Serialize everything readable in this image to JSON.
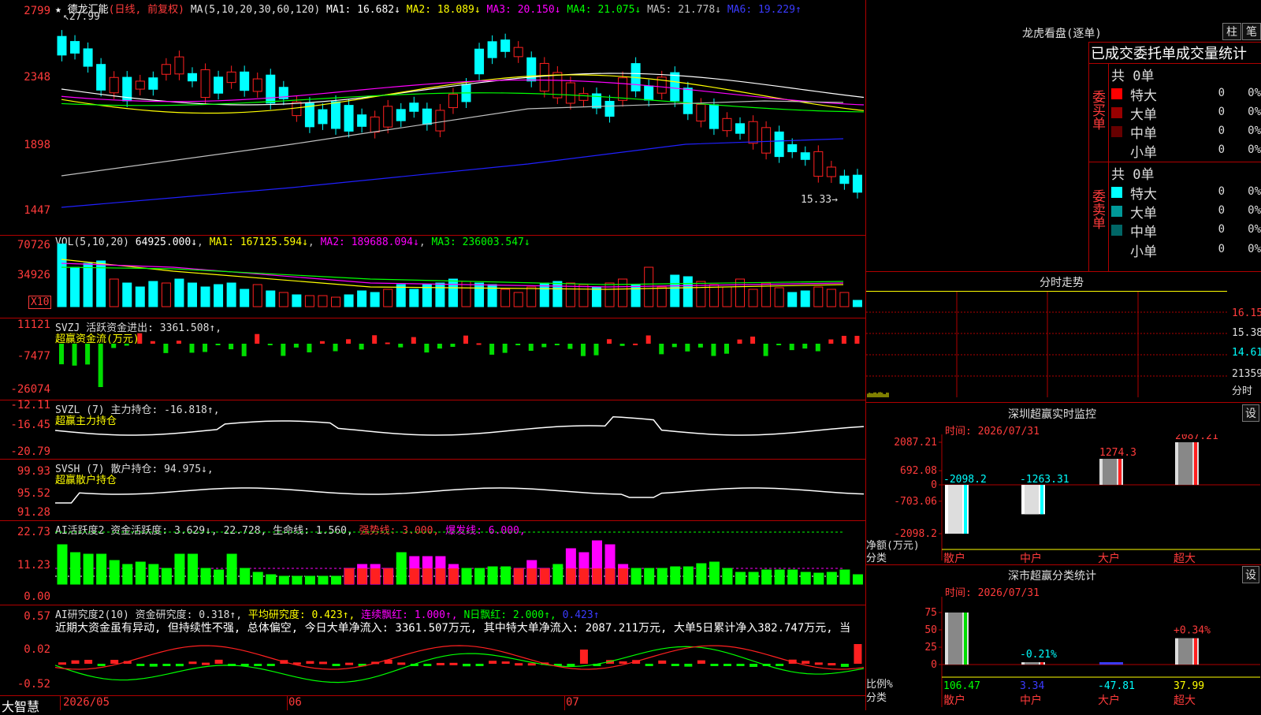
{
  "stock": {
    "name": "德龙汇能",
    "mode": "(日线, 前复权)",
    "ma_header": "MA(5,10,20,30,60,120)",
    "ma": [
      {
        "label": "MA1:",
        "value": "16.682↓",
        "color": "#ffffff"
      },
      {
        "label": "MA2:",
        "value": "18.089↓",
        "color": "#ffff00"
      },
      {
        "label": "MA3:",
        "value": "20.150↓",
        "color": "#ff00ff"
      },
      {
        "label": "MA4:",
        "value": "21.075↓",
        "color": "#00ff00"
      },
      {
        "label": "MA5:",
        "value": "21.778↓",
        "color": "#c0c0c0"
      },
      {
        "label": "MA6:",
        "value": "19.229↑",
        "color": "#3b3bff"
      }
    ],
    "price_axis": [
      "2799",
      "2348",
      "1898",
      "1447"
    ],
    "high_label": "27.99",
    "low_label": "15.33"
  },
  "volume": {
    "header": "VOL(5,10,20)",
    "vol": "64925.000↓",
    "ma1": "MA1: 167125.594↓",
    "ma2": "MA2: 189688.094↓",
    "ma3": "MA3: 236003.547↓",
    "axis": [
      "70726",
      "34926"
    ],
    "unit": "X10"
  },
  "svzj": {
    "header": "SVZJ  活跃资金进出: 3361.508↑,",
    "sub": "超赢资金流(万元)",
    "axis": [
      "11121",
      "-7477",
      "-26074"
    ]
  },
  "svzl": {
    "header": "SVZL (7) 主力持仓: -16.818↑,",
    "sub": "超赢主力持仓",
    "axis": [
      "-12.11",
      "-16.45",
      "-20.79"
    ]
  },
  "svsh": {
    "header": "SVSH (7) 散户持仓: 94.975↓,",
    "sub": "超赢散户持仓",
    "axis": [
      "99.93",
      "95.52",
      "91.28"
    ]
  },
  "ai_active": {
    "header": "AI活跃度2 资金活跃度: 3.629↓, 22.728, 生命线: 1.560,",
    "strong": "强势线: 3.000,",
    "burst": "爆发线: 6.000,",
    "axis": [
      "22.73",
      "11.23",
      "0.00"
    ]
  },
  "ai_research": {
    "header_a": "AI研究度2(10) 资金研究度: 0.318↑,",
    "avg": "平均研究度: 0.423↑,",
    "streak": "连续飘红: 1.000↑,",
    "nday": "N日飘红: 2.000↑,",
    "last": "0.423↑",
    "comment": "近期大资金虽有异动, 但持续性不强, 总体偏空, 今日大单净流入: 3361.507万元, 其中特大单净流入: 2087.211万元, 大单5日累计净入382.747万元, 当",
    "axis": [
      "0.57",
      "0.02",
      "-0.52"
    ]
  },
  "date_axis": {
    "brand": "大智慧",
    "labels": [
      "2026/05",
      "06",
      "07"
    ]
  },
  "right": {
    "dragon_title": "龙虎看盘(逐单)",
    "btn_a": "柱",
    "btn_b": "笔",
    "order_title": "已成交委托单成交量统计",
    "buy_side": {
      "vlabel": "委买单",
      "total": "共 0单",
      "rows": [
        {
          "label": "特大",
          "value": "0",
          "pct": "0%",
          "color": "#ff0000"
        },
        {
          "label": "大单",
          "value": "0",
          "pct": "0%",
          "color": "#990000"
        },
        {
          "label": "中单",
          "value": "0",
          "pct": "0%",
          "color": "#660000"
        },
        {
          "label": "小单",
          "value": "0",
          "pct": "0%",
          "color": "#000000"
        }
      ]
    },
    "sell_side": {
      "vlabel": "委卖单",
      "total": "共 0单",
      "rows": [
        {
          "label": "特大",
          "value": "0",
          "pct": "0%",
          "color": "#00ffff"
        },
        {
          "label": "大单",
          "value": "0",
          "pct": "0%",
          "color": "#009999"
        },
        {
          "label": "中单",
          "value": "0",
          "pct": "0%",
          "color": "#006666"
        },
        {
          "label": "小单",
          "value": "0",
          "pct": "0%",
          "color": "#000000"
        }
      ]
    },
    "intraday": {
      "title": "分时走势",
      "labels": [
        "16.15",
        "15.38",
        "14.61",
        "21359",
        "分时"
      ]
    },
    "sz_monitor": {
      "title": "深圳超赢实时监控",
      "btn": "设",
      "time": "时间: 2026/07/31",
      "axis": [
        "2087.21",
        "692.08",
        "0",
        "-703.06",
        "-2098.2"
      ],
      "ylabel": "净额(万元)",
      "xlabel": "分类",
      "categories": [
        "散户",
        "中户",
        "大户",
        "超大"
      ],
      "values": [
        -2098.2,
        -1263.31,
        1274.3,
        2087.21
      ],
      "value_labels": [
        "-2098.2",
        "-1263.31",
        "1274.3",
        "2087.21"
      ]
    },
    "sz_stats": {
      "title": "深市超赢分类统计",
      "btn": "设",
      "time": "时间: 2026/07/31",
      "axis": [
        "75",
        "50",
        "25",
        "0"
      ],
      "ylabel": "比例%",
      "xlabel": "分类",
      "categories": [
        "散户",
        "中户",
        "大户",
        "超大"
      ],
      "bottom_values": [
        "106.47",
        "3.34",
        "-47.81",
        "37.99"
      ],
      "pct_labels": [
        "",
        "-0.21%",
        "",
        "+0.34%"
      ]
    }
  },
  "chart_data": [
    {
      "type": "bar",
      "title": "深圳超赢实时监控",
      "ylabel": "净额(万元)",
      "xlabel": "分类",
      "categories": [
        "散户",
        "中户",
        "大户",
        "超大"
      ],
      "values": [
        -2098.2,
        -1263.31,
        1274.3,
        2087.21
      ],
      "ylim": [
        -2098.2,
        2087.21
      ]
    },
    {
      "type": "bar",
      "title": "深市超赢分类统计",
      "ylabel": "比例%",
      "xlabel": "分类",
      "categories": [
        "散户",
        "中户",
        "大户",
        "超大"
      ],
      "values": [
        106.47,
        3.34,
        -47.81,
        37.99
      ],
      "ylim": [
        0,
        75
      ]
    }
  ]
}
